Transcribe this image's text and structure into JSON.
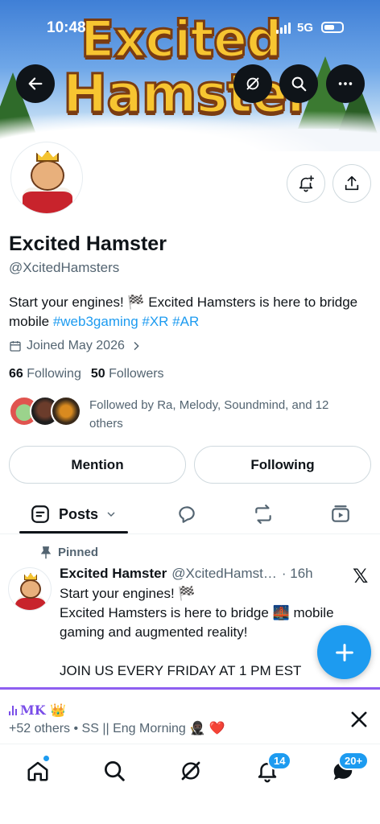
{
  "status_bar": {
    "time": "10:48",
    "network": "5G"
  },
  "banner": {
    "logo_line1": "Excited",
    "logo_line2": "Hamster"
  },
  "profile": {
    "name": "Excited Hamster",
    "handle": "@XcitedHamsters",
    "bio_text": "Start your engines! 🏁 Excited Hamsters is here to bridge mobile ",
    "bio_tags": "#web3gaming #XR #AR",
    "joined": "Joined May 2026",
    "following_count": "66",
    "following_label": "Following",
    "followers_count": "50",
    "followers_label": "Followers",
    "followed_by": "Followed by Ra, Melody, Soundmind, and 12 others"
  },
  "buttons": {
    "mention": "Mention",
    "following": "Following"
  },
  "tabs": {
    "posts_label": "Posts"
  },
  "post": {
    "pinned_label": "Pinned",
    "author_name": "Excited Hamster",
    "author_handle": "@XcitedHamst…",
    "time": "· 16h",
    "x_logo": "𝕏",
    "line1": "Start your engines! 🏁",
    "line2": "Excited Hamsters is here to bridge 🌉 mobile gaming and augmented reality!",
    "line3": "JOIN US EVERY FRIDAY AT 1 PM EST"
  },
  "space": {
    "host": "MK 👑",
    "subtitle": "+52 others • SS || Eng Morning 🥷🏿 ❤️"
  },
  "nav": {
    "notifications_badge": "14",
    "messages_badge": "20+"
  },
  "colors": {
    "accent": "#1d9bf0",
    "space_purple": "#8e5ff0",
    "text": "#0f1419",
    "muted": "#536471"
  }
}
